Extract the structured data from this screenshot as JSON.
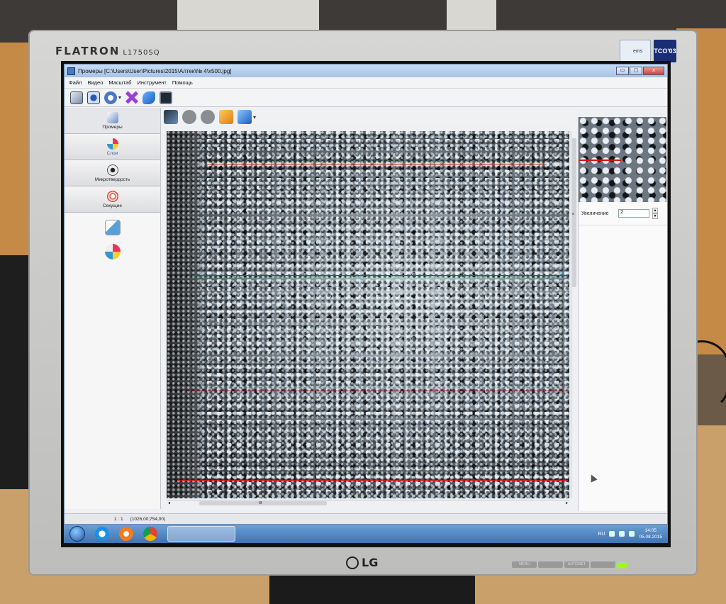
{
  "monitor": {
    "brand": "FLATRON",
    "model": "L1750SQ",
    "manufacturer": "LG",
    "sticker_ems": "ems",
    "sticker_tco": "TCO'03",
    "front_buttons": [
      "MENU",
      "",
      "AUTO/SET",
      "",
      ""
    ]
  },
  "window": {
    "title": "Промеры [C:\\Users\\User\\Pictures\\2015\\Алтек\\№ 4\\x500.jpg]",
    "buttons": {
      "minimize": "▭",
      "maximize": "▢",
      "close": "x"
    }
  },
  "menu": {
    "items": [
      "Файл",
      "Видео",
      "Масштаб",
      "Инструмент",
      "Помощь"
    ]
  },
  "toolbar": {
    "icons": [
      "notebook-icon",
      "camera-icon",
      "scale-icon",
      "tools-icon",
      "rotate-icon",
      "exit-icon"
    ],
    "dropdown_glyph": "▾"
  },
  "left_panel": {
    "tabs": [
      {
        "label": "Промеры",
        "icon": "measure-icon"
      },
      {
        "label": "Слои",
        "icon": "layers-icon"
      },
      {
        "label": "Микротвердость",
        "icon": "microhardness-icon"
      },
      {
        "label": "Секущие",
        "icon": "secants-icon"
      }
    ],
    "sub_tools": [
      "pen-icon",
      "layers-small-icon"
    ]
  },
  "image_toolbar": {
    "icons": [
      "camera-capture-icon",
      "record-icon",
      "pause-icon",
      "open-folder-icon",
      "save-icon"
    ],
    "dropdown_glyph": "▾"
  },
  "right_panel": {
    "zoom_label": "Увеличение",
    "zoom_value": "2",
    "spin_up": "▲",
    "spin_down": "▼"
  },
  "status": {
    "scale": "1 : 1",
    "coords": "(1026,00;754,00)"
  },
  "scroll": {
    "h_grip": "III",
    "v_grip": "≡",
    "left_arrow": "◂",
    "right_arrow": "▸"
  },
  "taskbar": {
    "language": "RU",
    "time": "14:05",
    "date": "05.08.2015",
    "apps": [
      "ie-icon",
      "media-player-icon",
      "chrome-icon",
      "measure-app-icon"
    ]
  },
  "colors": {
    "measure_line": "#d11111",
    "taskbar": "#3f74b3",
    "titlebar": "#a6c3e8"
  }
}
